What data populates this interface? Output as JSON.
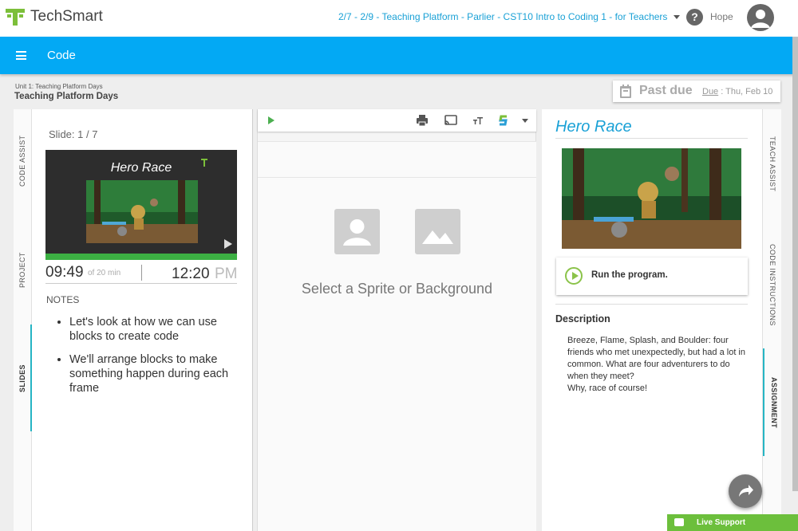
{
  "header": {
    "brand": "TechSmart",
    "course": "2/7 - 2/9 - Teaching Platform - Parlier - CST10 Intro to Coding 1 - for Teachers",
    "help": "?",
    "user": "Hope"
  },
  "bluebar": {
    "title": "Code"
  },
  "breadcrumb": {
    "unit": "Unit 1: Teaching Platform Days",
    "lesson": "Teaching Platform Days"
  },
  "status": {
    "label": "Past due",
    "due_label": "Due",
    "due_date": ": Thu, Feb 10"
  },
  "left_tabs": [
    "CODE ASSIST",
    "PROJECT",
    "SLIDES"
  ],
  "slides": {
    "counter": "Slide: 1 / 7",
    "thumb_title": "Hero Race",
    "elapsed": "09:49",
    "of_total": "of 20 min",
    "clock": "12:20",
    "ampm": "PM",
    "notes_label": "NOTES",
    "notes": [
      "Let's look at how we can use blocks to create code",
      "We'll arrange blocks to make something happen during each frame"
    ]
  },
  "editor": {
    "placeholder": "Select a Sprite or Background"
  },
  "assignment": {
    "title": "Hero Race",
    "run_label": "Run the program.",
    "description_title": "Description",
    "description": "Breeze, Flame, Splash, and Boulder: four friends who met unexpectedly, but had a lot in common. What are four adventurers to do when they meet?",
    "description_tail": "Why, race of course!"
  },
  "right_tabs": [
    "TEACH ASSIST",
    "CODE INSTRUCTIONS",
    "ASSIGNMENT"
  ],
  "support": {
    "label": "Live Support"
  },
  "colors": {
    "brand_blue": "#03a9f4",
    "link_blue": "#1aa1d6",
    "accent_teal": "#26b5c4",
    "green": "#6cbf3c"
  }
}
